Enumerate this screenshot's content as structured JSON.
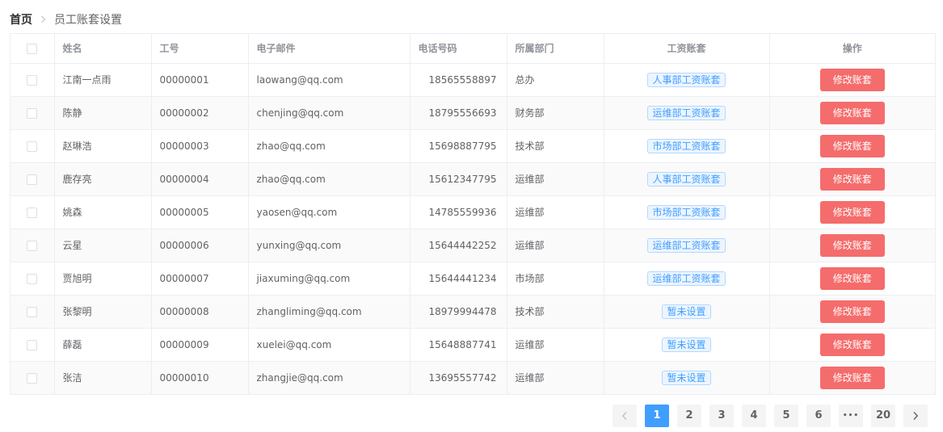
{
  "breadcrumb": {
    "home": "首页",
    "current": "员工账套设置"
  },
  "table": {
    "headers": {
      "name": "姓名",
      "work_id": "工号",
      "email": "电子邮件",
      "phone": "电话号码",
      "department": "所属部门",
      "salary_set": "工资账套",
      "actions": "操作"
    },
    "action_label": "修改账套",
    "rows": [
      {
        "name": "江南一点雨",
        "work_id": "00000001",
        "email": "laowang@qq.com",
        "phone": "18565558897",
        "department": "总办",
        "salary_set": "人事部工资账套"
      },
      {
        "name": "陈静",
        "work_id": "00000002",
        "email": "chenjing@qq.com",
        "phone": "18795556693",
        "department": "财务部",
        "salary_set": "运维部工资账套"
      },
      {
        "name": "赵琳浩",
        "work_id": "00000003",
        "email": "zhao@qq.com",
        "phone": "15698887795",
        "department": "技术部",
        "salary_set": "市场部工资账套"
      },
      {
        "name": "鹿存亮",
        "work_id": "00000004",
        "email": "zhao@qq.com",
        "phone": "15612347795",
        "department": "运维部",
        "salary_set": "人事部工资账套"
      },
      {
        "name": "姚森",
        "work_id": "00000005",
        "email": "yaosen@qq.com",
        "phone": "14785559936",
        "department": "运维部",
        "salary_set": "市场部工资账套"
      },
      {
        "name": "云星",
        "work_id": "00000006",
        "email": "yunxing@qq.com",
        "phone": "15644442252",
        "department": "运维部",
        "salary_set": "运维部工资账套"
      },
      {
        "name": "贾旭明",
        "work_id": "00000007",
        "email": "jiaxuming@qq.com",
        "phone": "15644441234",
        "department": "市场部",
        "salary_set": "运维部工资账套"
      },
      {
        "name": "张黎明",
        "work_id": "00000008",
        "email": "zhangliming@qq.com",
        "phone": "18979994478",
        "department": "技术部",
        "salary_set": "暂未设置"
      },
      {
        "name": "薛磊",
        "work_id": "00000009",
        "email": "xuelei@qq.com",
        "phone": "15648887741",
        "department": "运维部",
        "salary_set": "暂未设置"
      },
      {
        "name": "张洁",
        "work_id": "00000010",
        "email": "zhangjie@qq.com",
        "phone": "13695557742",
        "department": "运维部",
        "salary_set": "暂未设置"
      }
    ]
  },
  "pagination": {
    "current_page": "1",
    "pages": [
      "1",
      "2",
      "3",
      "4",
      "5",
      "6"
    ],
    "ellipsis": "•••",
    "last_page": "20"
  },
  "colors": {
    "primary": "#409eff",
    "danger": "#f56c6c",
    "tag_bg": "#ecf5ff",
    "tag_border": "#b3d8ff"
  }
}
